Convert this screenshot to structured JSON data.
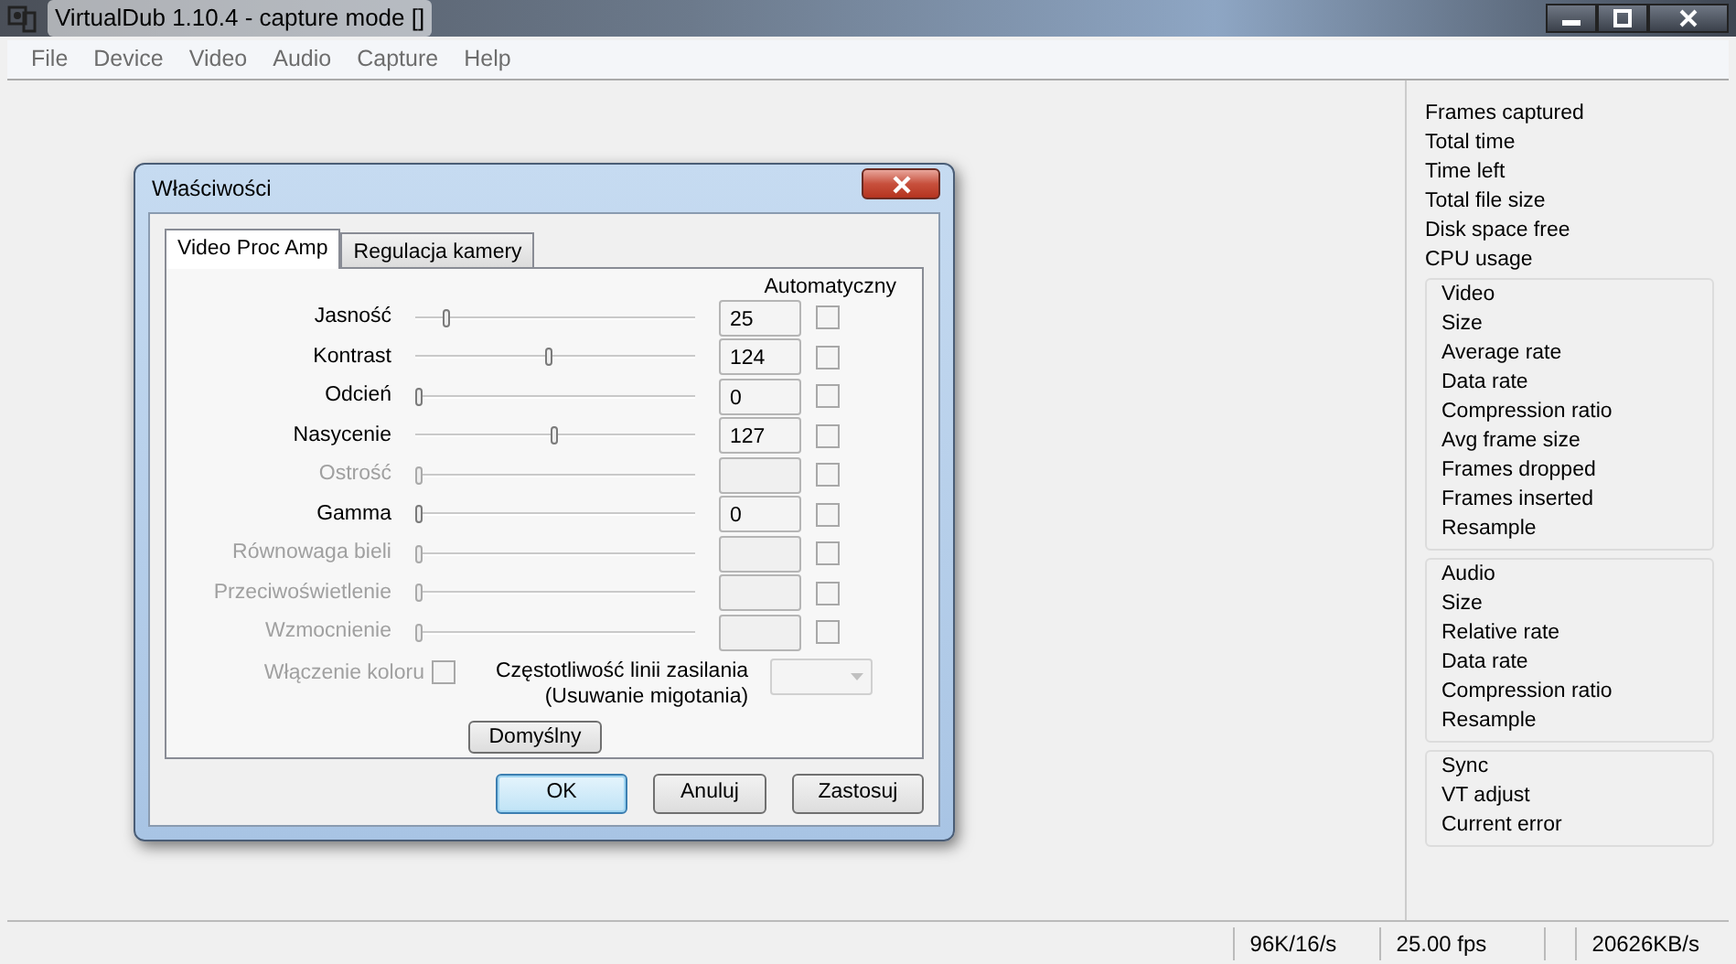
{
  "window": {
    "title": "VirtualDub 1.10.4 - capture mode []"
  },
  "menu": [
    "File",
    "Device",
    "Video",
    "Audio",
    "Capture",
    "Help"
  ],
  "dialog": {
    "title": "Właściwości",
    "tabs": [
      {
        "label": "Video Proc Amp",
        "selected": true
      },
      {
        "label": "Regulacja kamery",
        "selected": false
      }
    ],
    "auto_header": "Automatyczny",
    "controls": [
      {
        "label": "Jasność",
        "disabled": false,
        "level": 0.1,
        "value": "25",
        "auto": false
      },
      {
        "label": "Kontrast",
        "disabled": false,
        "level": 0.48,
        "value": "124",
        "auto": false
      },
      {
        "label": "Odcień",
        "disabled": false,
        "level": 0,
        "value": "0",
        "auto": false
      },
      {
        "label": "Nasycenie",
        "disabled": false,
        "level": 0.5,
        "value": "127",
        "auto": false
      },
      {
        "label": "Ostrość",
        "disabled": true,
        "level": 0,
        "auto": false
      },
      {
        "label": "Gamma",
        "disabled": false,
        "level": 0,
        "value": "0",
        "auto": false
      },
      {
        "label": "Równowaga bieli",
        "disabled": true,
        "level": 0,
        "auto": false
      },
      {
        "label": "Przeciwoświetlenie",
        "disabled": true,
        "level": 0,
        "auto": false
      },
      {
        "label": "Wzmocnienie",
        "disabled": true,
        "level": 0,
        "auto": false
      }
    ],
    "color_enable": {
      "label": "Włączenie koloru",
      "checked": false,
      "disabled": true
    },
    "power_line": {
      "label": "Częstotliwość linii zasilania",
      "sublabel": "(Usuwanie migotania)",
      "disabled": true
    },
    "default_button": "Domyślny",
    "buttons": [
      {
        "label": "OK",
        "default": true
      },
      {
        "label": "Anuluj",
        "default": false
      },
      {
        "label": "Zastosuj",
        "default": false
      }
    ]
  },
  "stats": {
    "items": [
      "Frames captured",
      "Total time",
      "Time left",
      "Total file size",
      "Disk space free",
      "CPU usage"
    ],
    "groups": [
      {
        "title": "Video",
        "items": [
          "Size",
          "Average rate",
          "Data rate",
          "Compression ratio",
          "Avg frame size",
          "Frames dropped",
          "Frames inserted",
          "Resample"
        ]
      },
      {
        "title": "Audio",
        "items": [
          "Size",
          "Relative rate",
          "Data rate",
          "Compression ratio",
          "Resample"
        ]
      },
      {
        "title": "Sync",
        "items": [
          "VT adjust",
          "Current error"
        ]
      }
    ]
  },
  "status_bar": [
    "96K/16/s",
    "25.00 fps",
    "20626KB/s"
  ]
}
